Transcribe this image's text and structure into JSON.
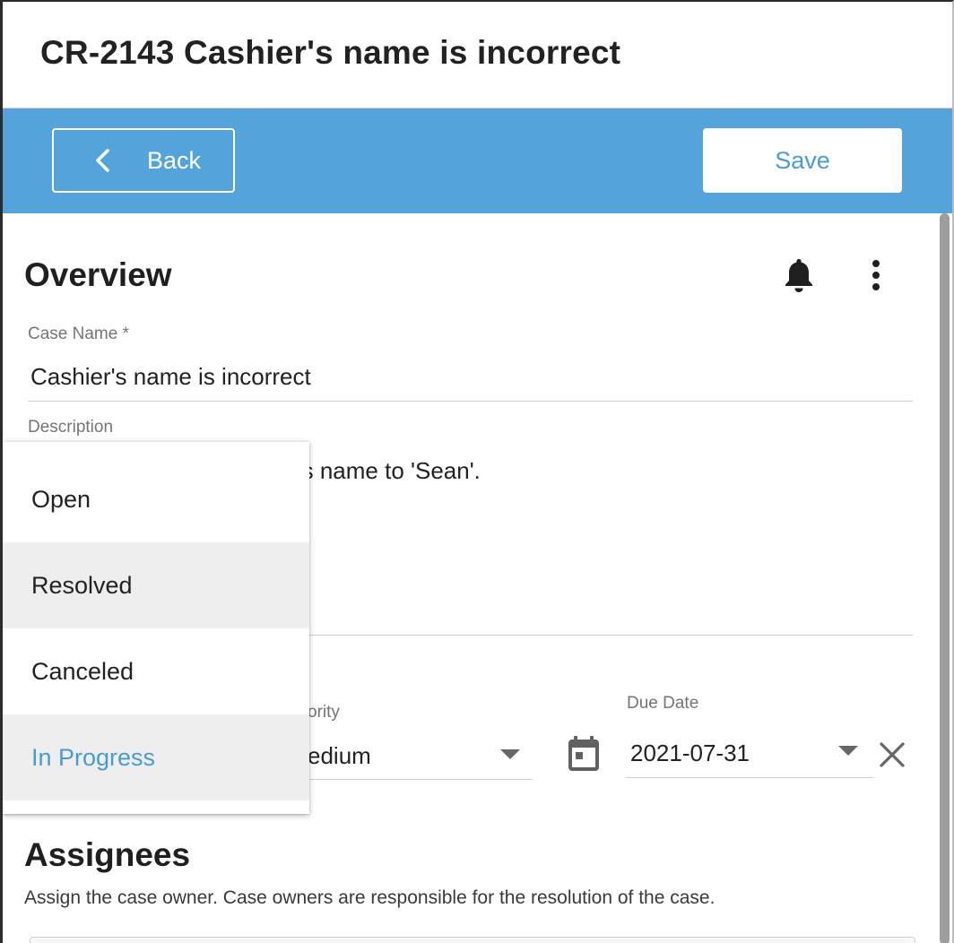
{
  "header": {
    "title": "CR-2143 Cashier's name is incorrect"
  },
  "toolbar": {
    "back_label": "Back",
    "save_label": "Save"
  },
  "overview": {
    "title": "Overview",
    "case_name_label": "Case Name *",
    "case_name_value": "Cashier's name is incorrect",
    "description_label": "Description",
    "description_visible_text": "r's name to 'Sean'."
  },
  "priority": {
    "label_visible": "ority",
    "value_visible": "edium"
  },
  "due_date": {
    "label": "Due Date",
    "value": "2021-07-31"
  },
  "status_menu": {
    "items": [
      {
        "label": "Open",
        "state": "normal"
      },
      {
        "label": "Resolved",
        "state": "hover"
      },
      {
        "label": "Canceled",
        "state": "normal"
      },
      {
        "label": "In Progress",
        "state": "selected"
      }
    ]
  },
  "assignees": {
    "title": "Assignees",
    "description": "Assign the case owner. Case owners are responsible for the resolution of the case."
  },
  "icons": {
    "back": "chevron-left-icon",
    "bell": "bell-icon",
    "more": "more-vertical-icon",
    "calendar": "calendar-icon",
    "clear": "close-icon",
    "dropdown": "caret-down-icon"
  },
  "colors": {
    "toolbar_bg": "#54a3da",
    "accent": "#4a9ad3",
    "menu_hover": "#eeeeee"
  }
}
